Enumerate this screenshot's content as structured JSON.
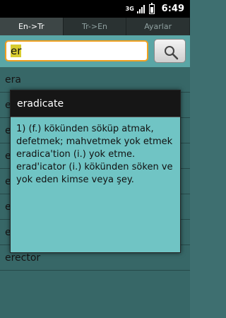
{
  "status_bar": {
    "network_label": "3G",
    "clock": "6:49",
    "icons": [
      "network-3g-icon",
      "signal-icon",
      "battery-icon"
    ]
  },
  "tabs": [
    {
      "label": "En->Tr",
      "active": true
    },
    {
      "label": "Tr->En",
      "active": false
    },
    {
      "label": "Ayarlar",
      "active": false
    }
  ],
  "search": {
    "value": "er",
    "button_icon": "search-icon"
  },
  "results": [
    "era",
    "e",
    "e",
    "e",
    "e",
    "erectile",
    "erection",
    "erector"
  ],
  "dialog": {
    "title": "eradicate",
    "definition": "1) (f.) kökünden söküp atmak, defetmek; mahvetmek yok etmek eradica'tion (i.) yok etme. erad'icator (i.) kökünden söken ve yok eden kimse veya şey."
  },
  "colors": {
    "list_bg": "#5aa6a6",
    "dialog_bg": "#70c4c4",
    "input_border": "#f0a020"
  }
}
